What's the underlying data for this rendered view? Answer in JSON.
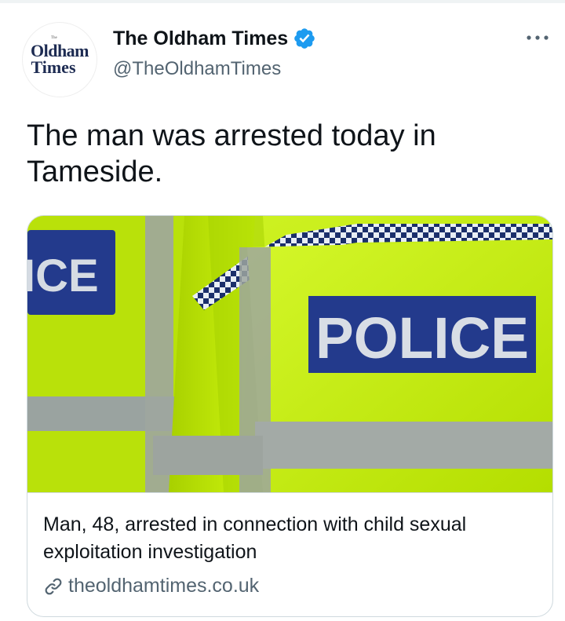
{
  "account": {
    "display_name": "The Oldham Times",
    "handle": "@TheOldhamTimes",
    "verified": true,
    "avatar": {
      "line1": "Oldham",
      "line2": "Times",
      "mark": "The"
    }
  },
  "tweet": {
    "text": "The man was arrested today in Tameside."
  },
  "card": {
    "image_texts": {
      "patch_left": "ICE",
      "patch_main": "POLICE"
    },
    "title": "Man, 48, arrested in connection with child sexual exploitation investigation",
    "domain": "theoldhamtimes.co.uk"
  },
  "icons": {
    "verified": "verified-badge-icon",
    "more": "more-options-icon",
    "link": "link-icon"
  },
  "colors": {
    "verified_blue": "#1d9bf0",
    "text_primary": "#0f1419",
    "text_secondary": "#536471",
    "hi_vis_yellow": "#c8f400",
    "police_blue": "#233a8c"
  }
}
